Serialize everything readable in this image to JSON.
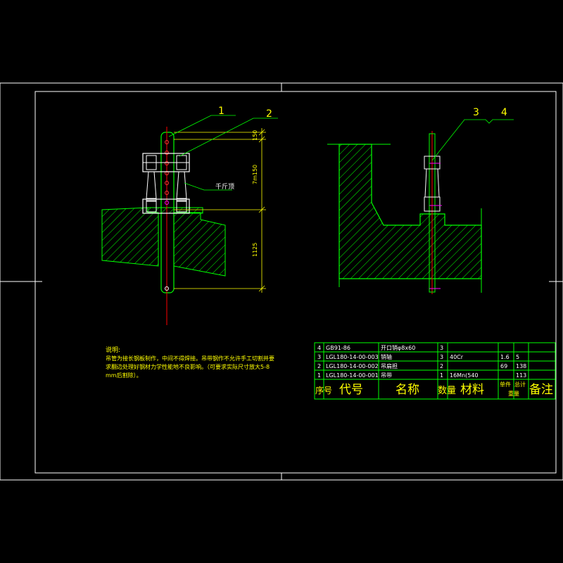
{
  "callouts": {
    "c1": "1",
    "c2": "2",
    "c3": "3",
    "c4": "4",
    "jack": "千斤顶"
  },
  "dimensions": {
    "d1": "150",
    "d2": "7m150",
    "d3": "1125"
  },
  "notes": {
    "title": "说明:",
    "line1": "吊管为接长钢板制作，中间不得焊接。吊带钢作不允许手工切割并要",
    "line2": "求翻边处理好钢材力学性能地不良影响。（可要求实际尺寸放大5-8",
    "line3": "mm后割除）。"
  },
  "bom": {
    "rows": [
      {
        "no": "4",
        "code": "GB91-86",
        "name": "开口销φ8x60",
        "qty": "3",
        "material": "",
        "unit_weight": "",
        "total_weight": "",
        "remark": ""
      },
      {
        "no": "3",
        "code": "LGL180-14-00-003",
        "name": "销轴",
        "qty": "3",
        "material": "40Cr",
        "unit_weight": "1.6",
        "total_weight": "5",
        "remark": ""
      },
      {
        "no": "2",
        "code": "LGL180-14-00-002",
        "name": "吊扁担",
        "qty": "2",
        "material": "",
        "unit_weight": "69",
        "total_weight": "138",
        "remark": ""
      },
      {
        "no": "1",
        "code": "LGL180-14-00-001",
        "name": "吊带",
        "qty": "1",
        "material": "16Mn(540",
        "unit_weight": "",
        "total_weight": "113",
        "remark": ""
      }
    ],
    "header": {
      "no": "序号",
      "code": "代号",
      "name": "名称",
      "qty": "数量",
      "material": "材料",
      "unit_weight": "单件",
      "total_weight": "总计",
      "weight_label": "重量",
      "remark": "备注"
    }
  },
  "colors": {
    "frame": "#ffffff",
    "drawing": "#00ff00",
    "annotation": "#ffff00",
    "hatch": "#00ff00",
    "center": "#ff0000",
    "pin": "#ff00ff"
  }
}
